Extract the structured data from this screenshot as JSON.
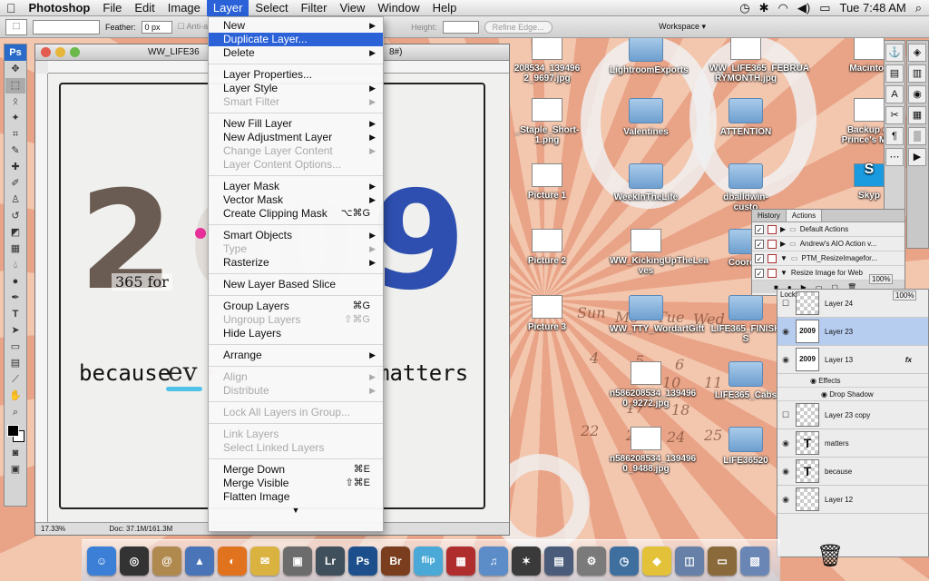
{
  "menubar": {
    "app": "Photoshop",
    "items": [
      "File",
      "Edit",
      "Image",
      "Layer",
      "Select",
      "Filter",
      "View",
      "Window",
      "Help"
    ],
    "clock": "Tue 7:48 AM"
  },
  "options": {
    "feather_label": "Feather:",
    "feather_value": "0 px",
    "antialias": "Anti-ali",
    "height_label": "Height:",
    "refine": "Refine Edge...",
    "workspace": "Workspace"
  },
  "tools": {
    "ps": "Ps"
  },
  "document": {
    "title": "WW_LIFE36",
    "title_tail": "8#)",
    "zoom": "17.33%",
    "doc_info": "Doc: 37.1M/161.3M",
    "art": {
      "year_left": "2",
      "year_right": "9",
      "year_faint": "00",
      "caption": "365 for",
      "line_a": "because",
      "line_b": "ev",
      "line_c": "matters"
    }
  },
  "layer_menu": {
    "groups": [
      [
        {
          "label": "New",
          "arrow": "▶"
        },
        {
          "label": "Duplicate Layer...",
          "highlight": true
        },
        {
          "label": "Delete",
          "arrow": "▶"
        }
      ],
      [
        {
          "label": "Layer Properties..."
        },
        {
          "label": "Layer Style",
          "arrow": "▶"
        },
        {
          "label": "Smart Filter",
          "arrow": "▶",
          "disabled": true
        }
      ],
      [
        {
          "label": "New Fill Layer",
          "arrow": "▶"
        },
        {
          "label": "New Adjustment Layer",
          "arrow": "▶"
        },
        {
          "label": "Change Layer Content",
          "arrow": "▶",
          "disabled": true
        },
        {
          "label": "Layer Content Options...",
          "disabled": true
        }
      ],
      [
        {
          "label": "Layer Mask",
          "arrow": "▶"
        },
        {
          "label": "Vector Mask",
          "arrow": "▶"
        },
        {
          "label": "Create Clipping Mask",
          "shortcut": "⌥⌘G"
        }
      ],
      [
        {
          "label": "Smart Objects",
          "arrow": "▶"
        },
        {
          "label": "Type",
          "arrow": "▶",
          "disabled": true
        },
        {
          "label": "Rasterize",
          "arrow": "▶"
        }
      ],
      [
        {
          "label": "New Layer Based Slice"
        }
      ],
      [
        {
          "label": "Group Layers",
          "shortcut": "⌘G"
        },
        {
          "label": "Ungroup Layers",
          "shortcut": "⇧⌘G",
          "disabled": true
        },
        {
          "label": "Hide Layers"
        }
      ],
      [
        {
          "label": "Arrange",
          "arrow": "▶"
        }
      ],
      [
        {
          "label": "Align",
          "arrow": "▶",
          "disabled": true
        },
        {
          "label": "Distribute",
          "arrow": "▶",
          "disabled": true
        }
      ],
      [
        {
          "label": "Lock All Layers in Group...",
          "disabled": true
        }
      ],
      [
        {
          "label": "Link Layers",
          "disabled": true
        },
        {
          "label": "Select Linked Layers",
          "disabled": true
        }
      ],
      [
        {
          "label": "Merge Down",
          "shortcut": "⌘E"
        },
        {
          "label": "Merge Visible",
          "shortcut": "⇧⌘E"
        },
        {
          "label": "Flatten Image"
        }
      ]
    ],
    "more": "▼"
  },
  "desktop": {
    "icons": [
      {
        "label": "208534_139496\n2_9697.jpg",
        "kind": "thumb"
      },
      {
        "label": "LightroomExports",
        "kind": "folder"
      },
      {
        "label": "WW_LIFE365_FEBRUA\nRYMONTH.jpg",
        "kind": "thumb"
      },
      {
        "label": "Macintos",
        "kind": "drive"
      },
      {
        "label": "_Staple_Short-\n1.png",
        "kind": "thumb"
      },
      {
        "label": "Valentines",
        "kind": "folder"
      },
      {
        "label": "ATTENTION",
        "kind": "folder"
      },
      {
        "label": "Backup of\nPrince's Mac",
        "kind": "drive"
      },
      {
        "label": "Picture 1",
        "kind": "thumb"
      },
      {
        "label": "WeekInTheLife",
        "kind": "folder"
      },
      {
        "label": "dballdwin-\ncusto",
        "kind": "folder"
      },
      {
        "label": "Skyp",
        "kind": "app"
      },
      {
        "label": "Picture 2",
        "kind": "thumb"
      },
      {
        "label": "WW_KickingUpTheLea\nves",
        "kind": "thumb"
      },
      {
        "label": "Coordin",
        "kind": "folder"
      },
      {
        "label": "Picture 3",
        "kind": "thumb"
      },
      {
        "label": "WW_TTY_WordartGift",
        "kind": "folder"
      },
      {
        "label": "LIFE365_FINISH\nS",
        "kind": "folder"
      },
      {
        "label": "n586208534_139496\n0_9272.jpg",
        "kind": "thumb"
      },
      {
        "label": "LIFE365_Cabs",
        "kind": "folder"
      },
      {
        "label": "n586208534_139496\n0_9488.jpg",
        "kind": "thumb"
      },
      {
        "label": "LIFE36520",
        "kind": "folder"
      }
    ],
    "calendar_days": [
      "Sun",
      "Mo",
      "Tue",
      "Wed",
      "4",
      "5",
      "6",
      "10",
      "11",
      "17",
      "18",
      "22",
      "23",
      "24",
      "25"
    ]
  },
  "actions_panel": {
    "tabs": [
      "History",
      "Actions"
    ],
    "rows": [
      {
        "label": "Default Actions",
        "type": "folder"
      },
      {
        "label": "Andrew's AIO Action v...",
        "type": "folder"
      },
      {
        "label": "PTM_ResizeImagefor...",
        "type": "folder-open"
      },
      {
        "label": "Resize Image for Web",
        "type": "action"
      }
    ],
    "opacity": "100%",
    "fill": "100%",
    "lock": "Lock:"
  },
  "layers_panel": {
    "rows": [
      {
        "name": "Layer 24",
        "thumb": "",
        "visible": false
      },
      {
        "name": "Layer 23",
        "thumb": "2009",
        "visible": true,
        "selected": true
      },
      {
        "name": "Layer 13",
        "thumb": "2009",
        "visible": true,
        "fx": "fx"
      },
      {
        "name": "Layer 23 copy",
        "thumb": "",
        "visible": false
      },
      {
        "name": "matters",
        "thumb": "T",
        "visible": true
      },
      {
        "name": "because",
        "thumb": "T",
        "visible": true
      },
      {
        "name": "Layer 12",
        "thumb": "",
        "visible": true
      }
    ],
    "effects": "Effects",
    "drop_shadow": "Drop Shadow"
  },
  "dock": {
    "apps": [
      {
        "name": "Finder",
        "glyph": "☺",
        "color": "#3b7fd6"
      },
      {
        "name": "Dashboard",
        "glyph": "◎",
        "color": "#333"
      },
      {
        "name": "Address Book",
        "glyph": "@",
        "color": "#b0894e"
      },
      {
        "name": "Preview",
        "glyph": "▲",
        "color": "#4a74b8"
      },
      {
        "name": "Firefox",
        "glyph": "◐",
        "color": "#e2731e"
      },
      {
        "name": "Mail",
        "glyph": "✉",
        "color": "#d9b240"
      },
      {
        "name": "iPhoto",
        "glyph": "▣",
        "color": "#6c6c6c"
      },
      {
        "name": "Lightroom",
        "glyph": "Lr",
        "color": "#3f4f5c"
      },
      {
        "name": "Photoshop",
        "glyph": "Ps",
        "color": "#1c4f8c"
      },
      {
        "name": "Bridge",
        "glyph": "Br",
        "color": "#7a3d1e"
      },
      {
        "name": "Flip",
        "glyph": "flip",
        "color": "#4aa9d6"
      },
      {
        "name": "Stickies",
        "glyph": "▦",
        "color": "#b02d2d"
      },
      {
        "name": "iTunes",
        "glyph": "♫",
        "color": "#5c8dc9"
      },
      {
        "name": "iMovie",
        "glyph": "✶",
        "color": "#3a3a3a"
      },
      {
        "name": "Spaces",
        "glyph": "▤",
        "color": "#4a5c7a"
      },
      {
        "name": "Utilities",
        "glyph": "⚙",
        "color": "#7a7a7a"
      },
      {
        "name": "Time Machine",
        "glyph": "◷",
        "color": "#3f6f9f"
      },
      {
        "name": "Cyberduck",
        "glyph": "◆",
        "color": "#e3c23a"
      },
      {
        "name": "Display",
        "glyph": "◫",
        "color": "#6680a8"
      },
      {
        "name": "Keynote",
        "glyph": "▭",
        "color": "#8a6a3a"
      },
      {
        "name": "Photos",
        "glyph": "▧",
        "color": "#6a86b5"
      }
    ]
  }
}
